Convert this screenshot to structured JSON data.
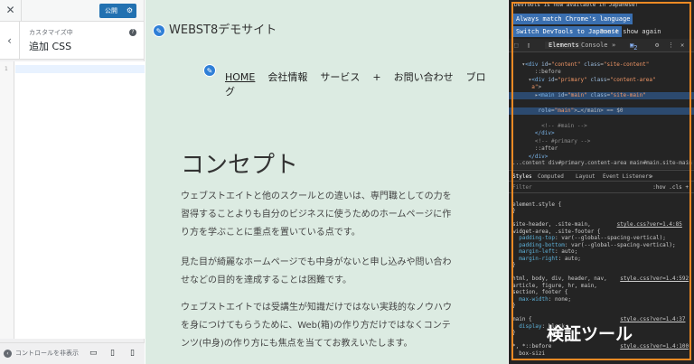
{
  "customizer": {
    "close": "✕",
    "publish": "公開",
    "subtitle": "カスタマイズ中",
    "title": "追加 CSS",
    "line_number": "1",
    "hide_controls": "コントロールを非表示"
  },
  "site": {
    "brand": "WEBST8デモサイト",
    "nav": [
      "HOME",
      "会社情報",
      "サービス",
      "+",
      "お問い合わせ",
      "ブログ"
    ],
    "heading": "コンセプト",
    "para1a": "ウェブストエイトと他のスクールとの違いは、専門職としての力を",
    "para1b": "習得することよりも自分のビジネスに使うためのホームページに作",
    "para1c": "り方を学ぶことに重点を置いている点です。",
    "para2a": "見た目が綺麗なホームページでも中身がないと申し込みや問い合わ",
    "para2b": "せなどの目的を達成することは困難です。",
    "para3a": "ウェブストエイトでは受講生が知識だけではない実践的なノウハウ",
    "para3b": "を身につけてもらうために、Web(箱)の作り方だけではなくコンテ",
    "para3c": "ンツ(中身)の作り方にも焦点を当ててお教えいたします。"
  },
  "devtools": {
    "notice": "DevTools is now available in Japanese!",
    "always_match": "Always match Chrome's language",
    "switch": "Switch DevTools to Japanese",
    "dont_show": "Don't show again",
    "tab_elements": "Elements",
    "tab_console": "Console",
    "more": "»",
    "issues": "2",
    "crumbs": "...content   div#primary.content-area   main#main.site-main",
    "styles": "Styles",
    "computed": "Computed",
    "layout": "Layout",
    "listeners": "Event Listeners",
    "filter": "Filter",
    "filter_right": ":hov  .cls  +",
    "overlay_label": "検証ツール"
  }
}
